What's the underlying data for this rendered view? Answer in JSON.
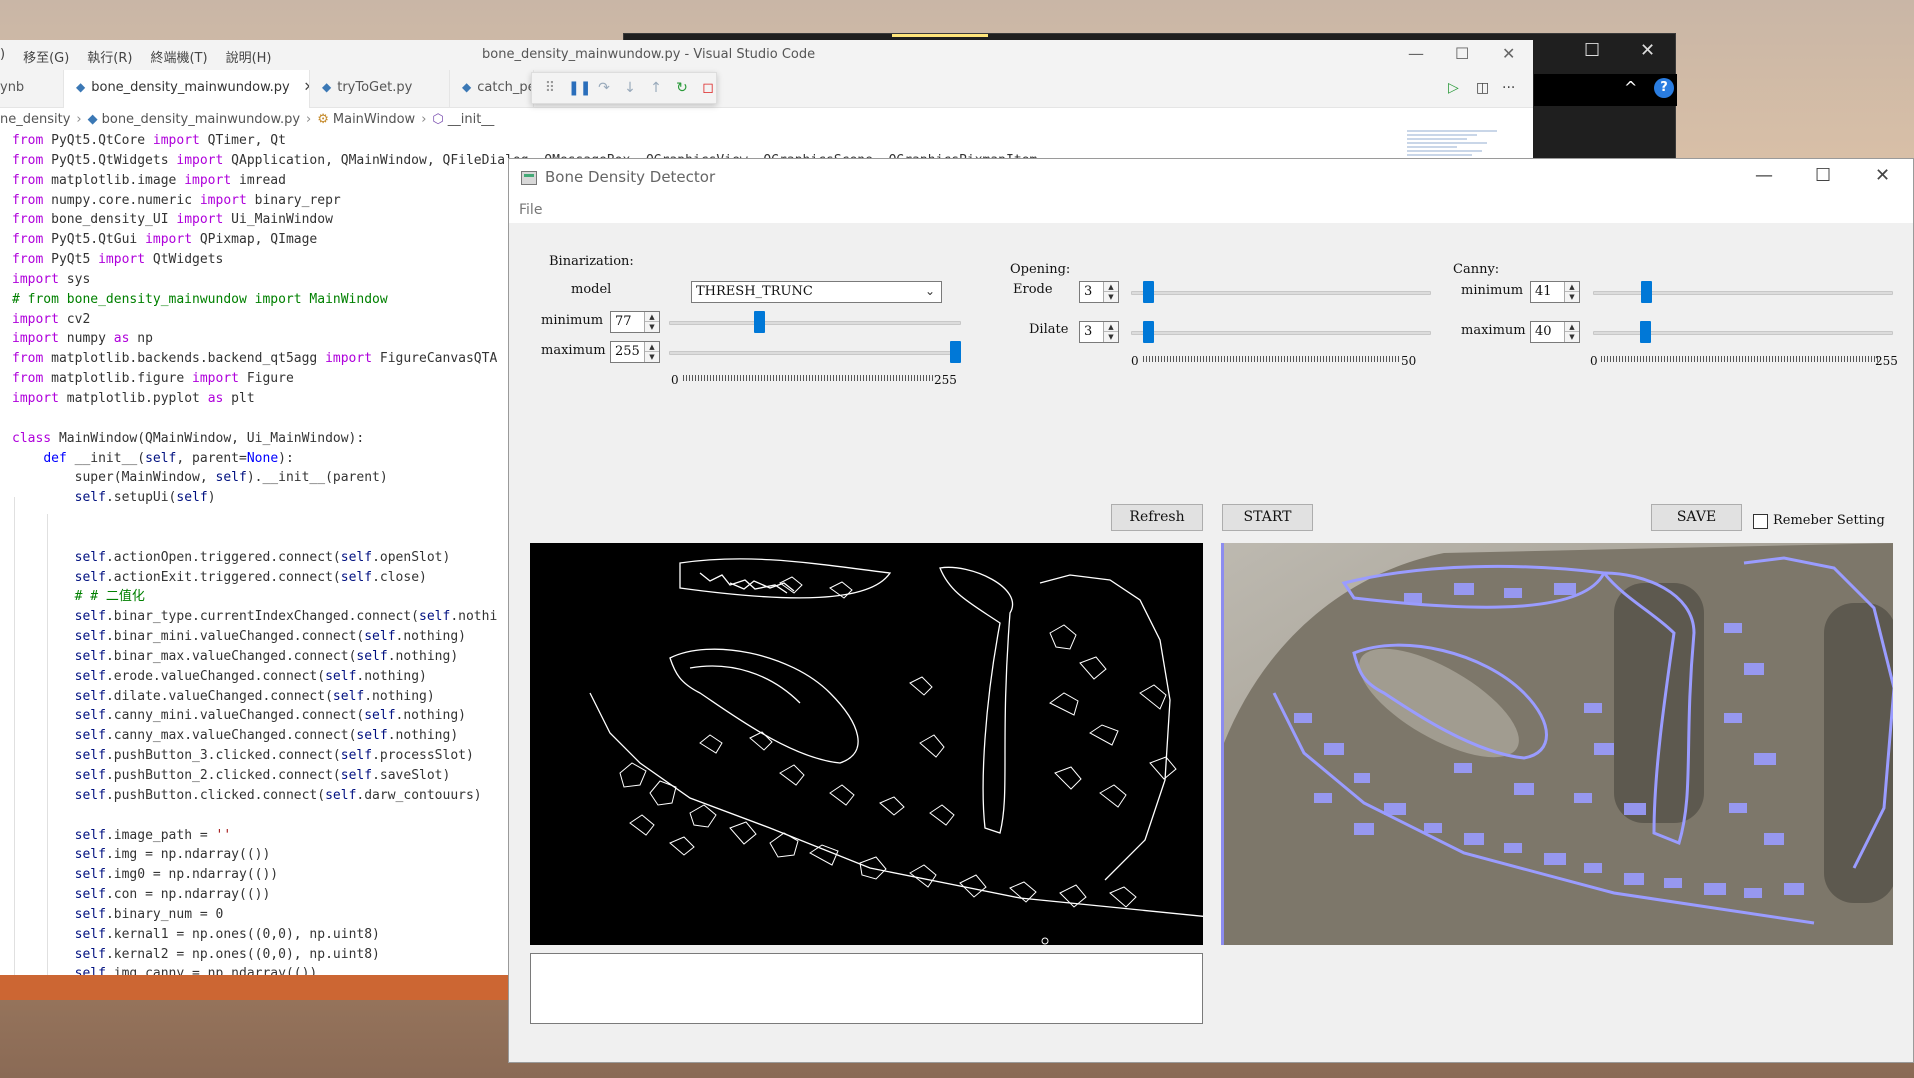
{
  "vscode": {
    "menu": [
      ")",
      "移至(G)",
      "執行(R)",
      "終端機(T)",
      "說明(H)"
    ],
    "title": "bone_density_mainwundow.py - Visual Studio Code",
    "tabs": [
      "ynb",
      "bone_density_mainwundow.py",
      "tryToGet.py",
      "catch_pe"
    ],
    "breadcrumb": [
      "ne_density",
      "bone_density_mainwundow.py",
      "MainWindow",
      "__init__"
    ],
    "code_lines": [
      "from PyQt5.QtCore import QTimer, Qt",
      "from PyQt5.QtWidgets import QApplication, QMainWindow, QFileDialog, QMessageBox, QGraphicsView, QGraphicsScene, QGraphicsPixmapItem",
      "from matplotlib.image import imread",
      "from numpy.core.numeric import binary_repr",
      "from bone_density_UI import Ui_MainWindow",
      "from PyQt5.QtGui import QPixmap, QImage",
      "from PyQt5 import QtWidgets",
      "import sys",
      "# from bone_density_mainwundow import MainWindow",
      "import cv2",
      "import numpy as np",
      "from matplotlib.backends.backend_qt5agg import FigureCanvasQTA",
      "from matplotlib.figure import Figure",
      "import matplotlib.pyplot as plt",
      "",
      "class MainWindow(QMainWindow, Ui_MainWindow):",
      "    def __init__(self, parent=None):",
      "        super(MainWindow, self).__init__(parent)",
      "        self.setupUi(self)",
      "",
      "",
      "        self.actionOpen.triggered.connect(self.openSlot)",
      "        self.actionExit.triggered.connect(self.close)",
      "        # # 二值化",
      "        self.binar_type.currentIndexChanged.connect(self.nothi",
      "        self.binar_mini.valueChanged.connect(self.nothing)",
      "        self.binar_max.valueChanged.connect(self.nothing)",
      "        self.erode.valueChanged.connect(self.nothing)",
      "        self.dilate.valueChanged.connect(self.nothing)",
      "        self.canny_mini.valueChanged.connect(self.nothing)",
      "        self.canny_max.valueChanged.connect(self.nothing)",
      "        self.pushButton_3.clicked.connect(self.processSlot)",
      "        self.pushButton_2.clicked.connect(self.saveSlot)",
      "        self.pushButton.clicked.connect(self.darw_contouurs)",
      "",
      "        self.image_path = ''",
      "        self.img = np.ndarray(())",
      "        self.img0 = np.ndarray(())",
      "        self.con = np.ndarray(())",
      "        self.binary_num = 0",
      "        self.kernal1 = np.ones((0,0), np.uint8)",
      "        self.kernal2 = np.ones((0,0), np.uint8)",
      "        self.img_canny = np.ndarray(())"
    ]
  },
  "app": {
    "title": "Bone Density Detector",
    "menu_file": "File",
    "binarization": {
      "title": "Binarization:",
      "model_label": "model",
      "model_value": "THRESH_TRUNC",
      "minimum_label": "minimum",
      "minimum_value": "77",
      "maximum_label": "maximum",
      "maximum_value": "255",
      "min_frac": 0.302,
      "max_frac": 1.0,
      "range_min": "0",
      "range_max": "255"
    },
    "opening": {
      "title": "Opening:",
      "erode_label": "Erode",
      "erode_value": "3",
      "dilate_label": "Dilate",
      "dilate_value": "3",
      "range_min": "0",
      "range_max": "50"
    },
    "canny": {
      "title": "Canny:",
      "minimum_label": "minimum",
      "minimum_value": "41",
      "maximum_label": "maximum",
      "maximum_value": "40",
      "range_min": "0",
      "range_max": "255"
    },
    "buttons": {
      "refresh": "Refresh",
      "start": "START",
      "save": "SAVE",
      "remember": "Remeber Setting"
    }
  }
}
